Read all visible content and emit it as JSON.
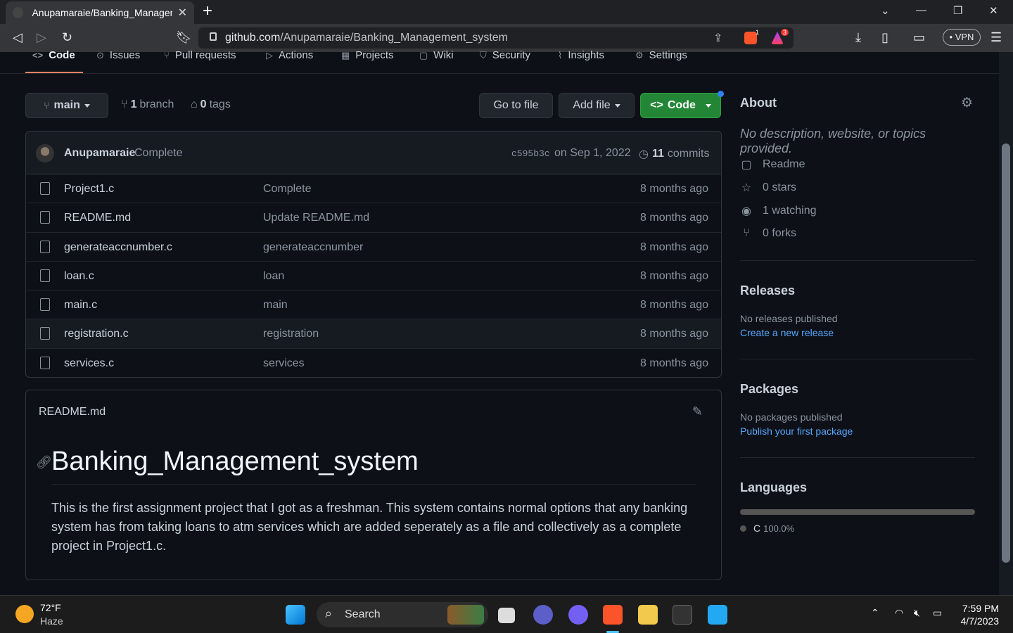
{
  "browser": {
    "tab_title": "Anupamaraie/Banking_Management_system",
    "url_domain": "github.com",
    "url_path": "/Anupamaraie/Banking_Management_system",
    "vpn_label": "• VPN",
    "shield_badge": "1",
    "alert_badge": "3"
  },
  "repo_nav": {
    "tabs": [
      {
        "label": "Code",
        "icon": "code-icon"
      },
      {
        "label": "Issues",
        "icon": "issue-icon"
      },
      {
        "label": "Pull requests",
        "icon": "pull-request-icon"
      },
      {
        "label": "Actions",
        "icon": "play-icon"
      },
      {
        "label": "Projects",
        "icon": "table-icon"
      },
      {
        "label": "Wiki",
        "icon": "book-icon"
      },
      {
        "label": "Security",
        "icon": "shield-icon"
      },
      {
        "label": "Insights",
        "icon": "graph-icon"
      },
      {
        "label": "Settings",
        "icon": "gear-icon"
      }
    ]
  },
  "toolbar": {
    "branch_button": "main",
    "branch_count": "1",
    "branch_word": "branch",
    "tag_count": "0",
    "tag_word": "tags",
    "go_to_file": "Go to file",
    "add_file": "Add file",
    "code": "Code"
  },
  "commit": {
    "author": "Anupamaraie",
    "message": "Complete",
    "sha": "c595b3c",
    "date": "on Sep 1, 2022",
    "count": "11",
    "count_word": "commits"
  },
  "files": [
    {
      "name": "Project1.c",
      "message": "Complete",
      "age": "8 months ago"
    },
    {
      "name": "README.md",
      "message": "Update README.md",
      "age": "8 months ago"
    },
    {
      "name": "generateaccnumber.c",
      "message": "generateaccnumber",
      "age": "8 months ago"
    },
    {
      "name": "loan.c",
      "message": "loan",
      "age": "8 months ago"
    },
    {
      "name": "main.c",
      "message": "main",
      "age": "8 months ago"
    },
    {
      "name": "registration.c",
      "message": "registration",
      "age": "8 months ago"
    },
    {
      "name": "services.c",
      "message": "services",
      "age": "8 months ago"
    }
  ],
  "readme": {
    "file_label": "README.md",
    "heading": "Banking_Management_system",
    "body": "This is the first assignment project that I got as a freshman. This system contains normal options that any banking system has from taking loans to atm services which are added seperately as a file and collectively as a complete project in Project1.c."
  },
  "sidebar": {
    "about_title": "About",
    "about_desc": "No description, website, or topics provided.",
    "readme": "Readme",
    "stars": "0 stars",
    "watching": "1 watching",
    "forks": "0 forks",
    "releases_title": "Releases",
    "releases_none": "No releases published",
    "releases_link": "Create a new release",
    "packages_title": "Packages",
    "packages_none": "No packages published",
    "packages_link": "Publish your first package",
    "languages_title": "Languages",
    "lang_name": "C",
    "lang_pct": "100.0%"
  },
  "taskbar": {
    "weather_temp": "72°F",
    "weather_cond": "Haze",
    "search": "Search",
    "time": "7:59 PM",
    "date": "4/7/2023"
  }
}
